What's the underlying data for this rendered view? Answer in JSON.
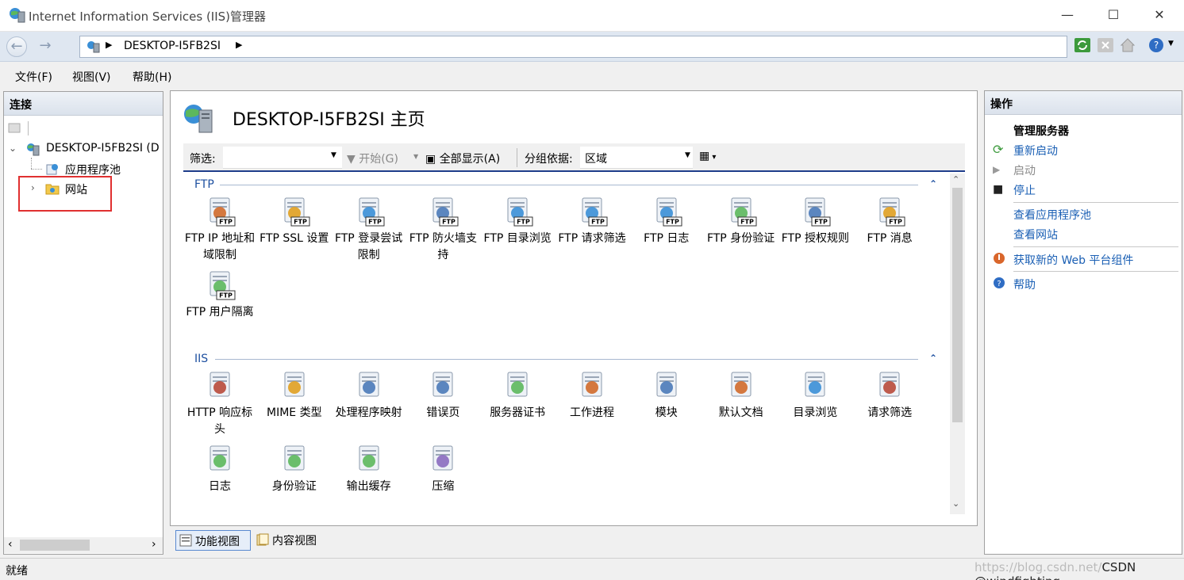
{
  "window": {
    "title": "Internet Information Services (IIS)管理器",
    "minimize": "—",
    "maximize": "☐",
    "close": "✕"
  },
  "address": {
    "path": "DESKTOP-I5FB2SI"
  },
  "menu": {
    "file": "文件(F)",
    "view": "视图(V)",
    "help": "帮助(H)"
  },
  "connections": {
    "header": "连接",
    "server": "DESKTOP-I5FB2SI (D",
    "app_pools": "应用程序池",
    "sites": "网站"
  },
  "main": {
    "title": "DESKTOP-I5FB2SI 主页",
    "filter_label": "筛选:",
    "start": "开始(G)",
    "show_all": "全部显示(A)",
    "group_by_label": "分组依据:",
    "group_by_value": "区域",
    "sections": [
      {
        "title": "FTP",
        "features": [
          {
            "label": "FTP IP 地址和域限制",
            "icon": "ftp-ip-restrictions-icon"
          },
          {
            "label": "FTP SSL 设置",
            "icon": "ftp-ssl-icon"
          },
          {
            "label": "FTP 登录尝试限制",
            "icon": "ftp-logon-attempts-icon"
          },
          {
            "label": "FTP 防火墙支持",
            "icon": "ftp-firewall-icon"
          },
          {
            "label": "FTP 目录浏览",
            "icon": "ftp-directory-browsing-icon"
          },
          {
            "label": "FTP 请求筛选",
            "icon": "ftp-request-filtering-icon"
          },
          {
            "label": "FTP 日志",
            "icon": "ftp-logging-icon"
          },
          {
            "label": "FTP 身份验证",
            "icon": "ftp-authentication-icon"
          },
          {
            "label": "FTP 授权规则",
            "icon": "ftp-authorization-icon"
          },
          {
            "label": "FTP 消息",
            "icon": "ftp-messages-icon"
          },
          {
            "label": "FTP 用户隔离",
            "icon": "ftp-user-isolation-icon"
          }
        ]
      },
      {
        "title": "IIS",
        "features": [
          {
            "label": "HTTP 响应标头",
            "icon": "http-response-headers-icon"
          },
          {
            "label": "MIME 类型",
            "icon": "mime-types-icon"
          },
          {
            "label": "处理程序映射",
            "icon": "handler-mappings-icon"
          },
          {
            "label": "错误页",
            "icon": "error-pages-icon"
          },
          {
            "label": "服务器证书",
            "icon": "server-certificates-icon"
          },
          {
            "label": "工作进程",
            "icon": "worker-processes-icon"
          },
          {
            "label": "模块",
            "icon": "modules-icon"
          },
          {
            "label": "默认文档",
            "icon": "default-document-icon"
          },
          {
            "label": "目录浏览",
            "icon": "directory-browsing-icon"
          },
          {
            "label": "请求筛选",
            "icon": "request-filtering-icon"
          },
          {
            "label": "日志",
            "icon": "logging-icon"
          },
          {
            "label": "身份验证",
            "icon": "authentication-icon"
          },
          {
            "label": "输出缓存",
            "icon": "output-caching-icon"
          },
          {
            "label": "压缩",
            "icon": "compression-icon"
          }
        ]
      }
    ],
    "tabs": {
      "features_view": "功能视图",
      "content_view": "内容视图"
    }
  },
  "actions": {
    "header": "操作",
    "manage_server": "管理服务器",
    "restart": "重新启动",
    "start": "启动",
    "stop": "停止",
    "view_app_pools": "查看应用程序池",
    "view_sites": "查看网站",
    "get_web_components": "获取新的 Web 平台组件",
    "help": "帮助"
  },
  "status": {
    "text": "就绪",
    "watermark_url": "https://blog.csdn.net/",
    "watermark_brand": "CSDN @windfighting"
  },
  "colors": {
    "accent_blue": "#1a5fb4",
    "section_blue": "#1e50a0",
    "highlight_red": "#e03030"
  }
}
